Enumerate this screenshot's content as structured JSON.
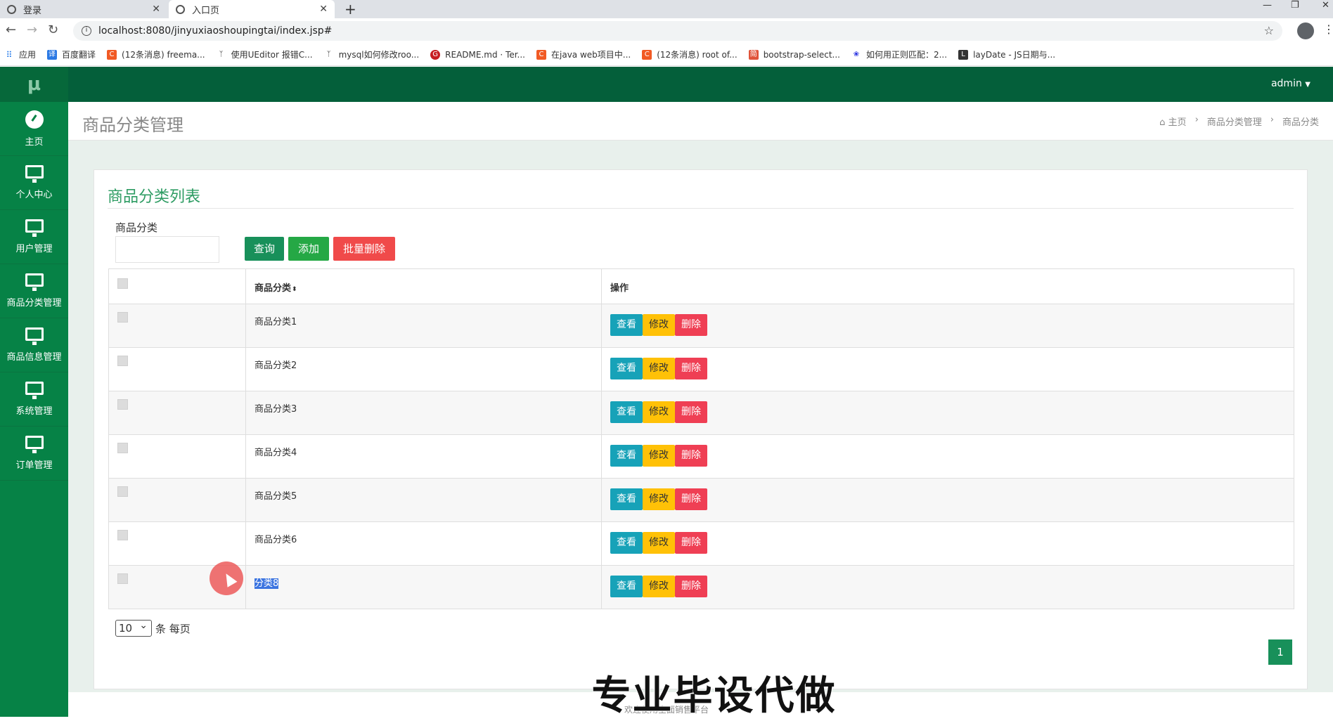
{
  "browser": {
    "tabs": [
      {
        "title": "登录"
      },
      {
        "title": "入口页"
      }
    ],
    "url": "localhost:8080/jinyuxiaoshoupingtai/index.jsp#",
    "bookmarks": [
      "应用",
      "百度翻译",
      "(12条消息) freema...",
      "使用UEditor 报错C...",
      "mysql如何修改roo...",
      "README.md · Ter...",
      "在java web项目中...",
      "(12条消息) root of...",
      "bootstrap-select...",
      "如何用正则匹配：2...",
      "layDate - JS日期与..."
    ]
  },
  "app": {
    "logo": "μ",
    "user": "admin",
    "sidebar": [
      {
        "label": "主页",
        "icon": "dashboard-icon"
      },
      {
        "label": "个人中心",
        "icon": "monitor-icon"
      },
      {
        "label": "用户管理",
        "icon": "monitor-icon"
      },
      {
        "label": "商品分类管理",
        "icon": "monitor-icon"
      },
      {
        "label": "商品信息管理",
        "icon": "monitor-icon"
      },
      {
        "label": "系统管理",
        "icon": "monitor-icon"
      },
      {
        "label": "订单管理",
        "icon": "monitor-icon"
      }
    ],
    "page_title": "商品分类管理",
    "breadcrumb": [
      "主页",
      "商品分类管理",
      "商品分类"
    ]
  },
  "panel": {
    "title": "商品分类列表",
    "filter_label": "商品分类",
    "filter_value": "",
    "buttons": {
      "query": "查询",
      "add": "添加",
      "bulk_delete": "批量删除"
    },
    "columns": [
      "商品分类",
      "操作"
    ],
    "rows": [
      {
        "name": "商品分类1"
      },
      {
        "name": "商品分类2"
      },
      {
        "name": "商品分类3"
      },
      {
        "name": "商品分类4"
      },
      {
        "name": "商品分类5"
      },
      {
        "name": "商品分类6"
      },
      {
        "name": "分类8"
      }
    ],
    "row_actions": {
      "view": "查看",
      "edit": "修改",
      "delete": "删除"
    },
    "page_size": "10",
    "page_size_suffix": "条 每页",
    "current_page": "1"
  },
  "footer": "欢迎使用全面销售平台",
  "watermark": "专业毕设代做"
}
